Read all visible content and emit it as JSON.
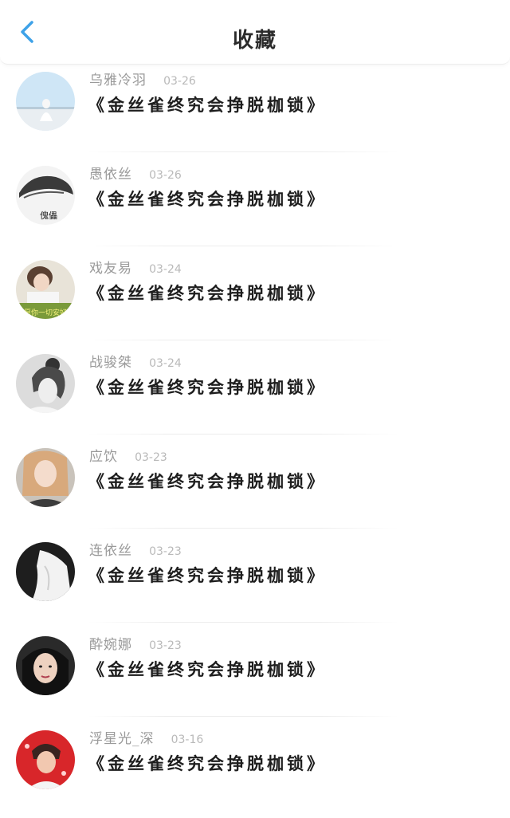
{
  "header": {
    "title": "收藏",
    "back_icon": "chevron-left-icon",
    "accent": "#3ea2e8"
  },
  "items": [
    {
      "name": "乌雅冷羽",
      "date": "03-26",
      "content": "《金丝雀终究会挣脱枷锁》",
      "avatar": "sky-silhouette"
    },
    {
      "name": "愚依丝",
      "date": "03-26",
      "content": "《金丝雀终究会挣脱枷锁》",
      "avatar": "hair-bw",
      "avatar_text": "傀儡"
    },
    {
      "name": "戏友易",
      "date": "03-24",
      "content": "《金丝雀终究会挣脱枷锁》",
      "avatar": "girl-caption",
      "avatar_text": "愿你一切安好"
    },
    {
      "name": "战骏桀",
      "date": "03-24",
      "content": "《金丝雀终究会挣脱枷锁》",
      "avatar": "bun-bw"
    },
    {
      "name": "应饮",
      "date": "03-23",
      "content": "《金丝雀终究会挣脱枷锁》",
      "avatar": "blonde-girl"
    },
    {
      "name": "连依丝",
      "date": "03-23",
      "content": "《金丝雀终究会挣脱枷锁》",
      "avatar": "shirt-bw"
    },
    {
      "name": "酔婉娜",
      "date": "03-23",
      "content": "《金丝雀终究会挣脱枷锁》",
      "avatar": "woman-dark"
    },
    {
      "name": "浮星光_深",
      "date": "03-16",
      "content": "《金丝雀终究会挣脱枷锁》",
      "avatar": "red-boy"
    }
  ]
}
